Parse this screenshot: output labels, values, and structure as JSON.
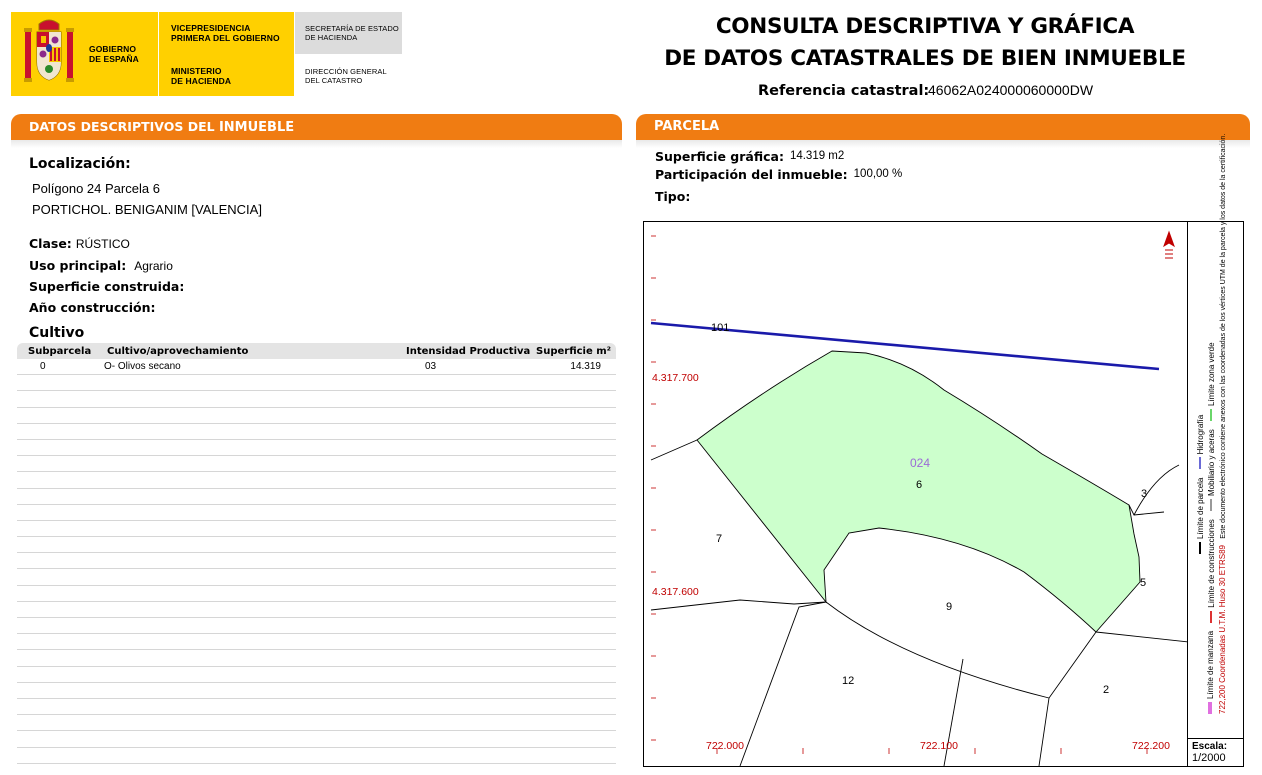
{
  "header": {
    "government": [
      "GOBIERNO",
      "DE ESPAÑA"
    ],
    "vicepresidency": [
      "VICEPRESIDENCIA",
      "PRIMERA DEL GOBIERNO"
    ],
    "ministry": [
      "MINISTERIO",
      "DE HACIENDA"
    ],
    "secretariat": [
      "SECRETARÍA DE ESTADO",
      "DE HACIENDA"
    ],
    "directorate": [
      "DIRECCIÓN GENERAL",
      "DEL CATASTRO"
    ],
    "title_line1": "CONSULTA DESCRIPTIVA Y GRÁFICA",
    "title_line2": "DE DATOS CATASTRALES DE BIEN INMUEBLE",
    "ref_label": "Referencia catastral:",
    "ref_value": "46062A024000060000DW"
  },
  "left": {
    "bar_title_a": "DATOS DESCRIPTIVOS DEL ",
    "bar_title_b": "INMUEBLE",
    "location_label": "Localización:",
    "location_line1": "Polígono 24 Parcela 6",
    "location_line2": "PORTICHOL. BENIGANIM [VALENCIA]",
    "clase_label": "Clase:",
    "clase_value": "RÚSTICO",
    "uso_label": "Uso principal:",
    "uso_value": "Agrario",
    "superficie_label": "Superficie construida:",
    "ano_label": "Año construcción:",
    "cultivo_title": "Cultivo",
    "table": {
      "headers": [
        "Subparcela",
        "Cultivo/aprovechamiento",
        "Intensidad Productiva",
        "Superficie m²"
      ],
      "rows": [
        [
          "0",
          "O- Olivos secano",
          "03",
          "14.319"
        ]
      ]
    }
  },
  "right": {
    "bar_title": "PARCELA",
    "superficie_label": "Superficie gráfica:",
    "superficie_value": "14.319 m2",
    "participacion_label": "Participación del inmueble:",
    "participacion_value": "100,00 %",
    "tipo_label": "Tipo:"
  },
  "map": {
    "parcel_code": "024",
    "parcel_labels": [
      "101",
      "6",
      "3",
      "7",
      "5",
      "9",
      "12",
      "2"
    ],
    "y_coords": [
      "4.317.700",
      "4.317.600"
    ],
    "x_coords": [
      "722.000",
      "722.100",
      "722.200"
    ],
    "scale_label": "Escala:",
    "scale_value": "1/2000",
    "legend": {
      "hidrografia": "Hidrografía",
      "zona_verde": "Límite zona verde",
      "parcela": "Límite de parcela",
      "mobiliario": "Mobiliario y aceras",
      "manzana": "Límite de manzana",
      "construcciones": "Límite de construcciones",
      "utm": "722,200 Coordenadas U.T.M. Huso 30 ETRS89",
      "note": "Este documento electrónico contiene anexos con las coordenadas de los vértices UTM de la parcela y los datos de la certificación."
    },
    "colors": {
      "parcel_fill": "#ccffcc",
      "hydro": "#1a1aaa",
      "coords": "#c00000",
      "manzana": "#e070e0",
      "construcciones": "#d33"
    }
  },
  "colors": {
    "accent": "#f07c12",
    "gov_yellow": "#ffd000"
  }
}
